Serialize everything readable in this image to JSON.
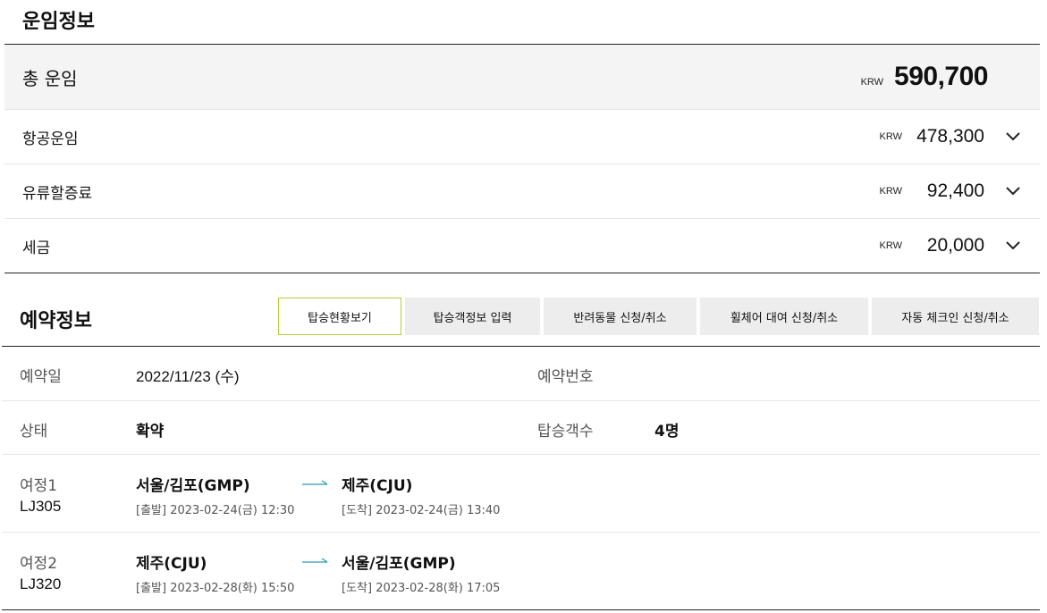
{
  "fare": {
    "title": "운임정보",
    "total": {
      "label": "총 운임",
      "currency": "KRW",
      "amount": "590,700"
    },
    "rows": [
      {
        "label": "항공운임",
        "currency": "KRW",
        "amount": "478,300",
        "icon": "chevron-down-icon"
      },
      {
        "label": "유류할증료",
        "currency": "KRW",
        "amount": "92,400",
        "icon": "chevron-down-icon"
      },
      {
        "label": "세금",
        "currency": "KRW",
        "amount": "20,000",
        "icon": "chevron-down-icon"
      }
    ]
  },
  "reservation": {
    "title": "예약정보",
    "tabs": [
      {
        "label": "탑승현황보기",
        "active": true
      },
      {
        "label": "탑승객정보 입력"
      },
      {
        "label": "반려동물 신청/취소"
      },
      {
        "label": "휠체어 대여 신청/취소"
      },
      {
        "label": "자동 체크인 신청/취소"
      }
    ],
    "booking_date_label": "예약일",
    "booking_date": "2022/11/23 (수)",
    "booking_number_label": "예약번호",
    "booking_number": "",
    "status_label": "상태",
    "status": "확약",
    "passengers_label": "탑승객수",
    "passengers": "4명",
    "trips": [
      {
        "label": "여정1",
        "flight": "LJ305",
        "from": "서울/김포(GMP)",
        "depart": "[출발] 2023-02-24(금) 12:30",
        "to": "제주(CJU)",
        "arrive": "[도착] 2023-02-24(금) 13:40"
      },
      {
        "label": "여정2",
        "flight": "LJ320",
        "from": "제주(CJU)",
        "depart": "[출발] 2023-02-28(화) 15:50",
        "to": "서울/김포(GMP)",
        "arrive": "[도착] 2023-02-28(화) 17:05"
      }
    ],
    "arrow_color": "#2a9bb5",
    "active_tab_border": "#b5cc3a"
  }
}
